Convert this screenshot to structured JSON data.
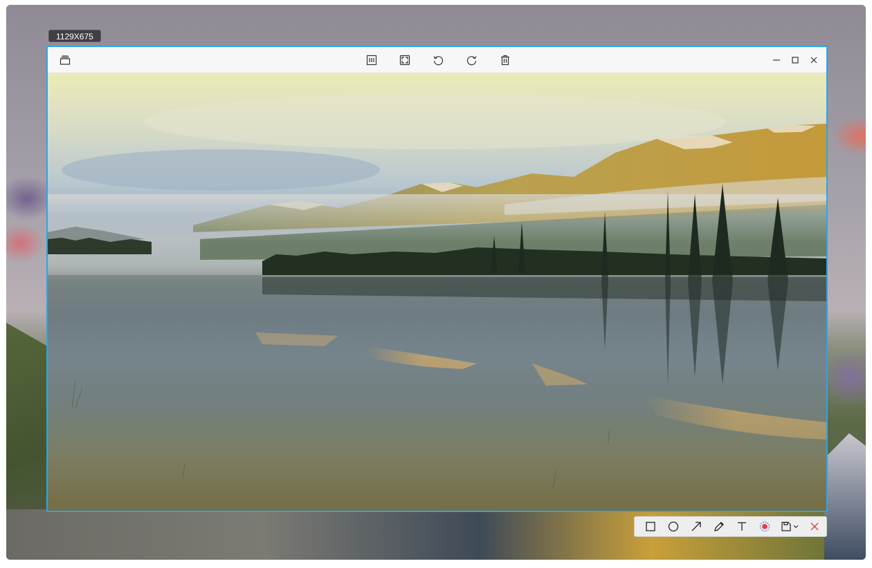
{
  "selection": {
    "size_label": "1129X675"
  },
  "viewer": {
    "titlebar": {
      "left_icon": "thumbnail-stack-icon",
      "center_tools": [
        "actual-size-icon",
        "fit-window-icon",
        "rotate-left-icon",
        "rotate-right-icon",
        "trash-icon"
      ],
      "window_controls": [
        "minimize-icon",
        "maximize-icon",
        "close-icon"
      ]
    },
    "image": {
      "subject": "lake-mountain-landscape"
    }
  },
  "annotation_toolbar": {
    "tools": [
      "rectangle-icon",
      "ellipse-icon",
      "arrow-icon",
      "pencil-icon",
      "text-icon",
      "color-picker-icon",
      "save-icon",
      "close-icon"
    ],
    "colors": {
      "selected_color": "#f2344a",
      "close": "#e0434b"
    }
  },
  "colors": {
    "accent": "#2ba6e8",
    "badge_bg": "#3f3f44"
  }
}
